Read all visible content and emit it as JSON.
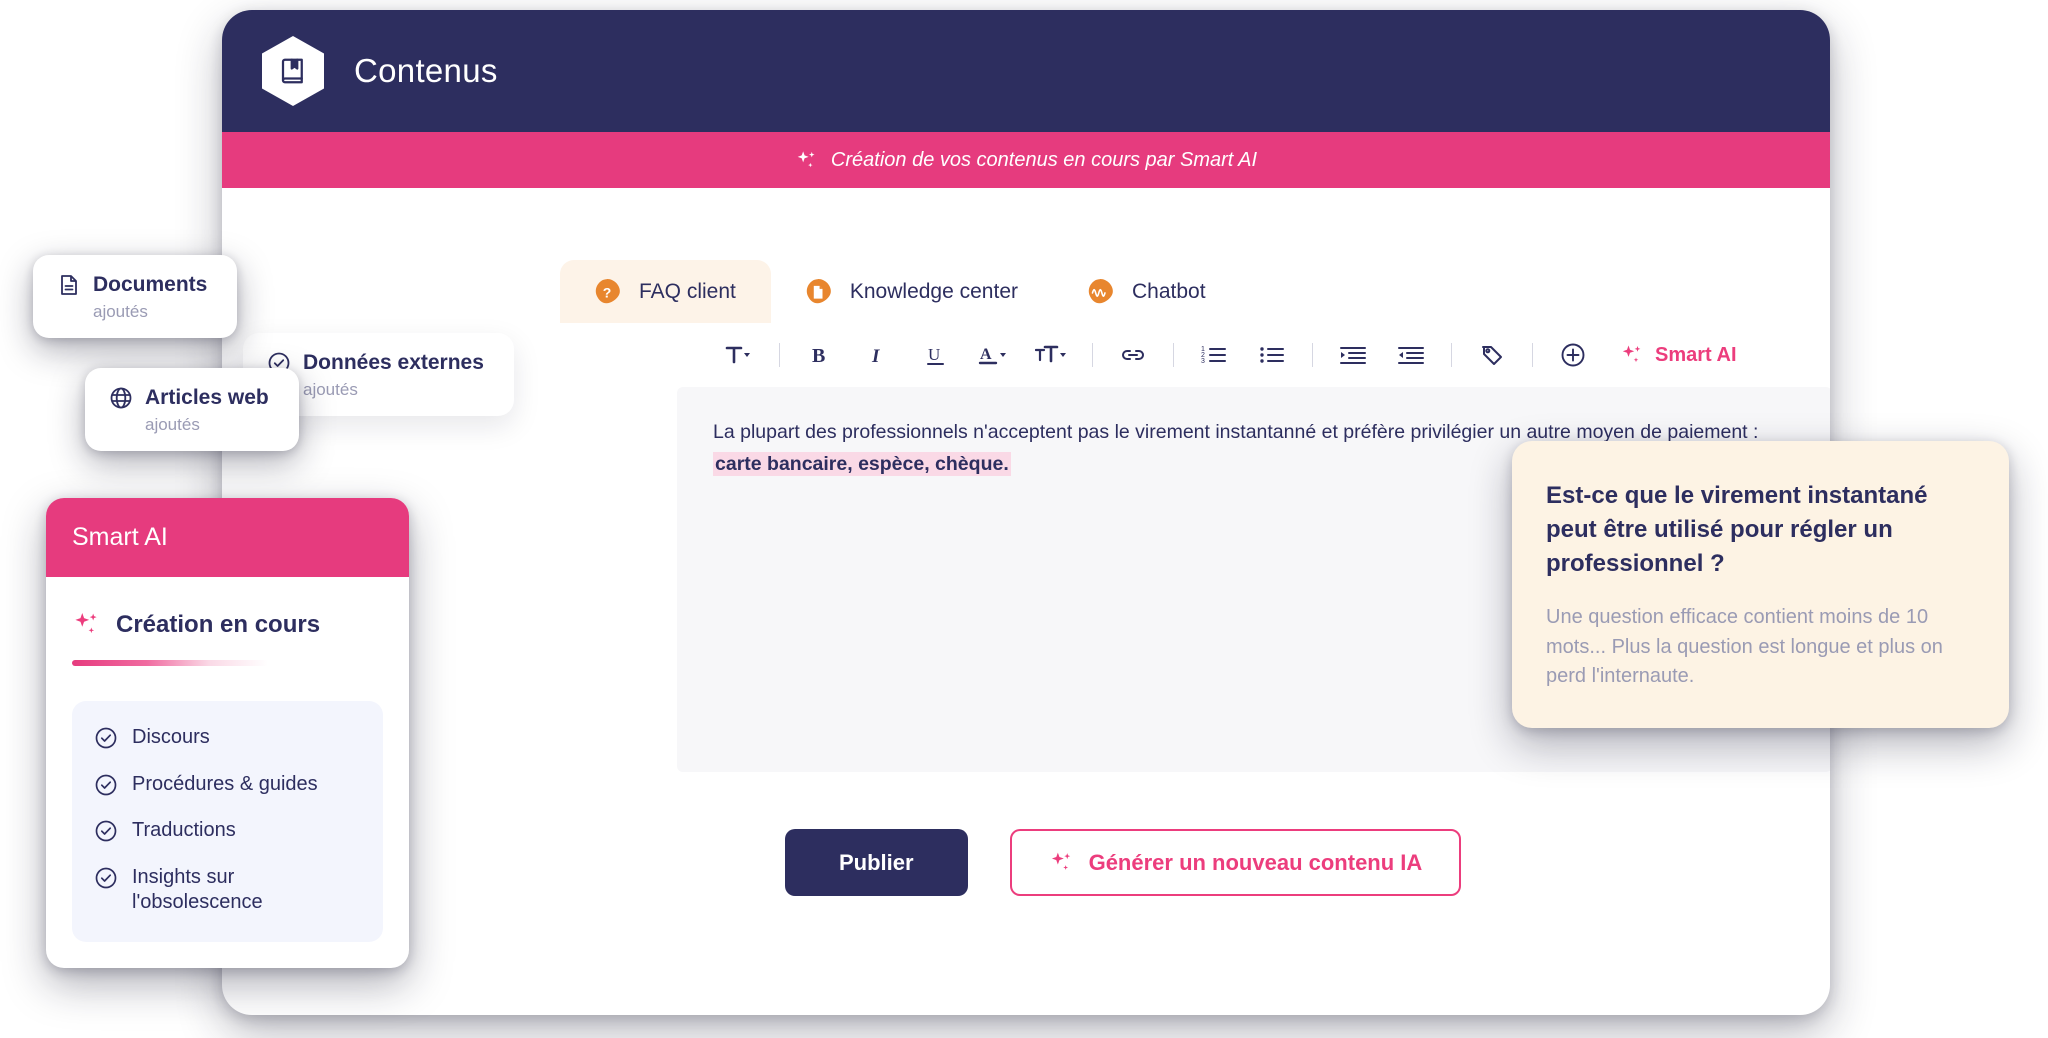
{
  "header": {
    "title": "Contenus",
    "logo_icon": "book-icon"
  },
  "banner": {
    "text": "Création de vos contenus en cours par Smart AI",
    "icon": "sparkle-icon",
    "bg_color": "#e63b7e"
  },
  "tabs": [
    {
      "label": "FAQ client",
      "icon": "question-badge-icon",
      "active": true
    },
    {
      "label": "Knowledge center",
      "icon": "document-badge-icon",
      "active": false
    },
    {
      "label": "Chatbot",
      "icon": "wave-badge-icon",
      "active": false
    }
  ],
  "toolbar": {
    "items": [
      {
        "name": "text-style-dropdown",
        "icon": "text-style-icon"
      },
      {
        "name": "bold-button",
        "icon": "bold-icon"
      },
      {
        "name": "italic-button",
        "icon": "italic-icon"
      },
      {
        "name": "underline-button",
        "icon": "underline-icon"
      },
      {
        "name": "text-color-dropdown",
        "icon": "text-color-icon"
      },
      {
        "name": "font-size-dropdown",
        "icon": "font-size-icon"
      },
      {
        "name": "link-button",
        "icon": "link-icon"
      },
      {
        "name": "ordered-list-button",
        "icon": "ordered-list-icon"
      },
      {
        "name": "bullet-list-button",
        "icon": "bullet-list-icon"
      },
      {
        "name": "indent-increase-button",
        "icon": "indent-increase-icon"
      },
      {
        "name": "indent-decrease-button",
        "icon": "indent-decrease-icon"
      },
      {
        "name": "tag-button",
        "icon": "tag-icon"
      },
      {
        "name": "add-button",
        "icon": "plus-circle-icon"
      }
    ],
    "smart_ai_label": "Smart AI",
    "smart_ai_color": "#ec3d7d"
  },
  "editor": {
    "paragraph_lead": "La plupart des professionnels n'acceptent pas le virement instantanné et préfère privilégier un autre moyen de paiement : ",
    "paragraph_highlight": "carte bancaire, espèce, chèque.",
    "highlight_color": "#fad9e6"
  },
  "footer": {
    "publish_label": "Publier",
    "generate_label": "Générer un nouveau contenu IA"
  },
  "floating_cards": [
    {
      "title": "Documents",
      "subtitle": "ajoutés",
      "icon": "document-icon"
    },
    {
      "title": "Données externes",
      "subtitle": "ajoutés",
      "icon": "check-circle-icon"
    },
    {
      "title": "Articles web",
      "subtitle": "ajoutés",
      "icon": "globe-icon"
    }
  ],
  "smart_ai_panel": {
    "header_title": "Smart AI",
    "status_label": "Création en cours",
    "status_icon": "sparkle-icon",
    "items": [
      {
        "label": "Discours",
        "icon": "check-circle-icon"
      },
      {
        "label": "Procédures & guides",
        "icon": "check-circle-icon"
      },
      {
        "label": "Traductions",
        "icon": "check-circle-icon"
      },
      {
        "label": "Insights sur l'obsolescence",
        "icon": "check-circle-icon"
      }
    ]
  },
  "tooltip": {
    "question": "Est-ce que le virement instantané peut être utilisé pour régler un professionnel ?",
    "hint": "Une question efficace contient moins de 10 mots... Plus la question est longue et plus on perd l'internaute.",
    "bg_color": "#fdf3e4"
  },
  "colors": {
    "navy": "#2d2e5f",
    "pink": "#e63b7e",
    "pink_accent": "#ec3d7d",
    "orange": "#e8862e",
    "peach": "#fdf3e8",
    "editor_bg": "#f7f7f9"
  }
}
